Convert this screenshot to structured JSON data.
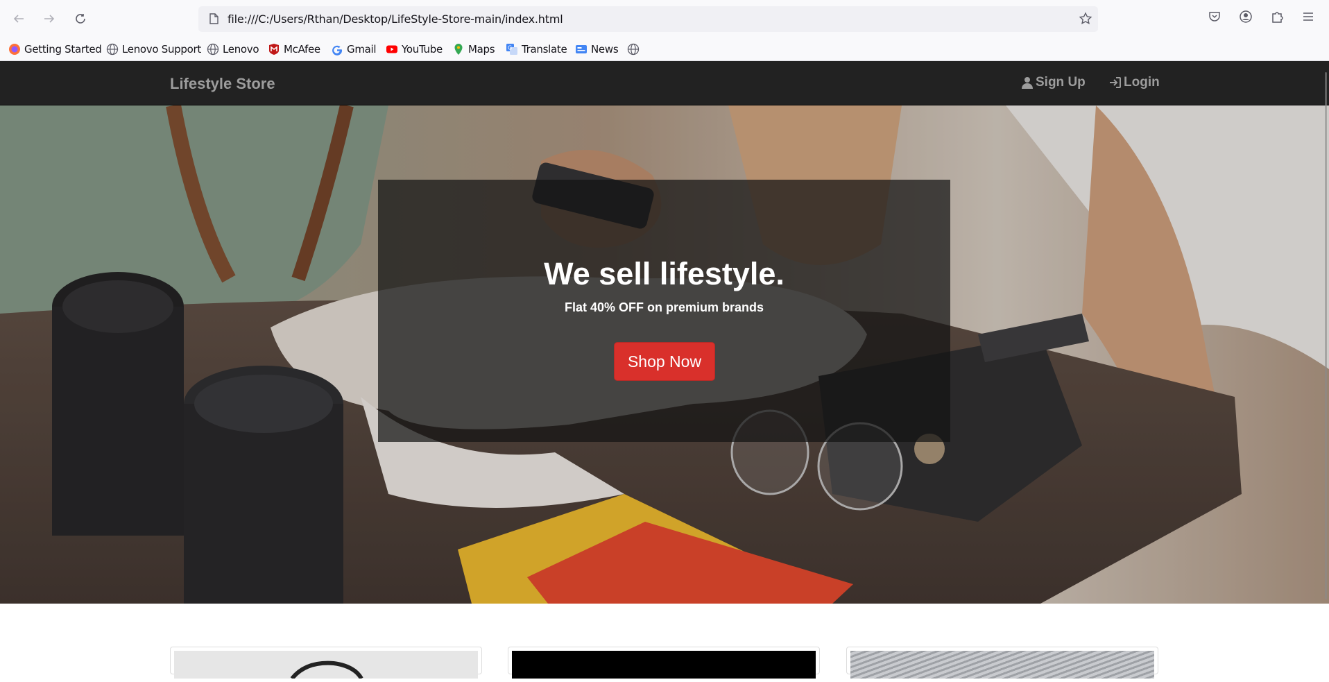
{
  "browser": {
    "url": "file:///C:/Users/Rthan/Desktop/LifeStyle-Store-main/index.html",
    "bookmarks": [
      {
        "label": "Getting Started",
        "icon": "firefox-icon"
      },
      {
        "label": "Lenovo Support",
        "icon": "globe-icon"
      },
      {
        "label": "Lenovo",
        "icon": "globe-icon"
      },
      {
        "label": "McAfee",
        "icon": "mcafee-icon"
      },
      {
        "label": "Gmail",
        "icon": "google-icon"
      },
      {
        "label": "YouTube",
        "icon": "youtube-icon"
      },
      {
        "label": "Maps",
        "icon": "maps-icon"
      },
      {
        "label": "Translate",
        "icon": "translate-icon"
      },
      {
        "label": "News",
        "icon": "news-icon"
      }
    ]
  },
  "site": {
    "brand": "Lifestyle Store",
    "nav": {
      "signup": "Sign Up",
      "login": "Login"
    },
    "hero": {
      "title": "We sell lifestyle.",
      "subtitle": "Flat 40% OFF on premium brands",
      "cta": "Shop Now"
    }
  },
  "colors": {
    "navbar": "#222222",
    "nav_text": "#9d9d9d",
    "cta": "#d9302b"
  }
}
